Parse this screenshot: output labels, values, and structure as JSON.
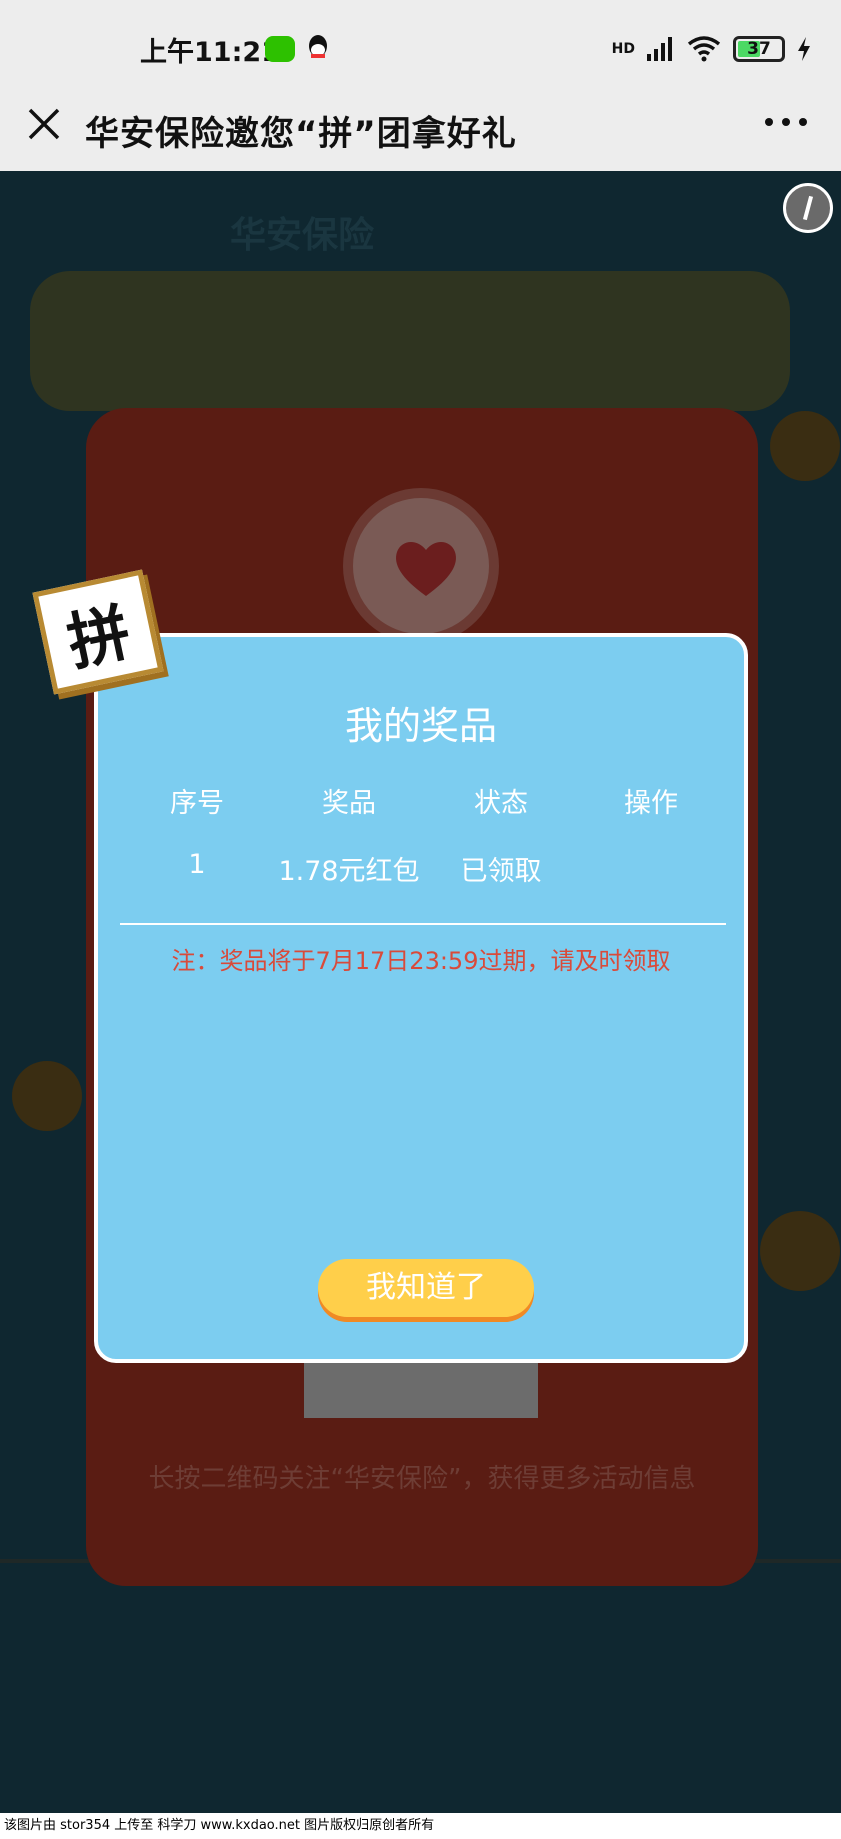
{
  "status_bar": {
    "time": "上午11:21",
    "network": "HD",
    "battery": "37",
    "icons": [
      "wechat-icon",
      "qq-icon",
      "signal-icon",
      "wifi-icon",
      "battery-icon",
      "charging-icon"
    ]
  },
  "header": {
    "title": "华安保险邀您“拼”团拿好礼",
    "close_icon": "close-icon",
    "more_icon": "more-icon"
  },
  "background": {
    "logo_text": "华安保险",
    "qr_hint": "长按二维码关注“华安保险”，获得更多活动信息"
  },
  "pin_badge": "拼",
  "modal": {
    "title": "我的奖品",
    "columns": [
      "序号",
      "奖品",
      "状态",
      "操作"
    ],
    "rows": [
      {
        "index": "1",
        "prize": "1.78元红包",
        "status": "已领取",
        "action": ""
      }
    ],
    "notice": "注：奖品将于7月17日23:59过期，请及时领取",
    "button": "我知道了"
  },
  "footer_watermark": "该图片由 stor354 上传至 科学刀 www.kxdao.net 图片版权归原创者所有",
  "colors": {
    "modal_bg": "#7ccdf0",
    "button": "#ffcf4a",
    "notice": "#d94a3a"
  }
}
